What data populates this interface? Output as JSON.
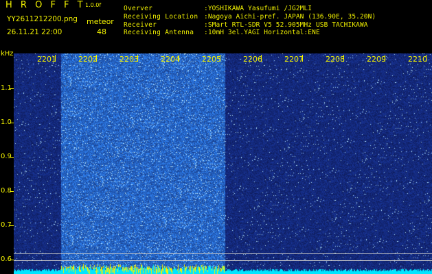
{
  "header": {
    "app_title": "H R O F F T",
    "version": "1.0.0f",
    "filename": "YY2611212200.png",
    "datetime": "26.11.21 22:00",
    "meteor_label": "meteor",
    "meteor_count": "48"
  },
  "info": [
    {
      "key": "Overver",
      "value": ":YOSHIKAWA Yasufumi /JG2MLI"
    },
    {
      "key": "Receiving Location",
      "value": ":Nagoya Aichi-pref. JAPAN (136.90E, 35.20N)"
    },
    {
      "key": "Receiver",
      "value": ":SMart RTL-SDR V5 52.905MHz USB TACHIKAWA"
    },
    {
      "key": "Receiving Antenna",
      "value": ":10mH 3el.YAGI Horizontal:ENE"
    }
  ],
  "axis": {
    "y_unit": "kHz",
    "y_ticks": [
      "1.1",
      "1.0",
      "0.9",
      "0.8",
      "0.7",
      "0.6"
    ],
    "x_ticks": [
      "2201",
      "2202",
      "2203",
      "2204",
      "2205",
      "2206",
      "2207",
      "2208",
      "2209",
      "2210"
    ]
  },
  "colors": {
    "label": "#f2f200",
    "background": "#000000",
    "noise_low": "#0a1247",
    "noise_high": "#3a8cff",
    "signal_base": "#00e5ff"
  }
}
